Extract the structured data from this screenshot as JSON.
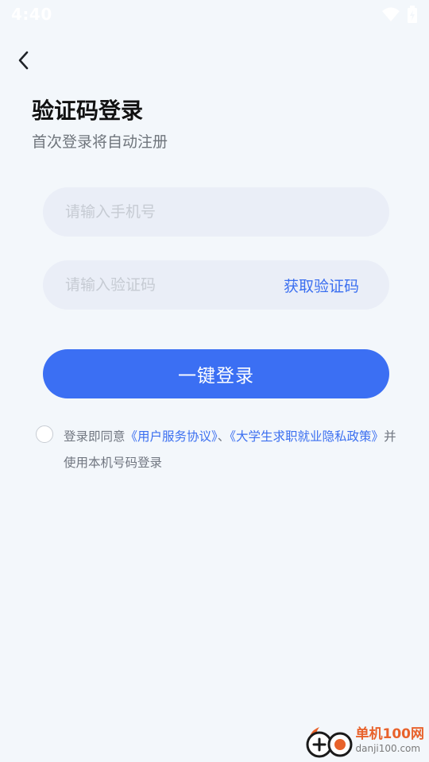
{
  "status_bar": {
    "time": "4:40"
  },
  "header": {
    "back_icon": "chevron-left-icon",
    "title": "验证码登录",
    "subtitle": "首次登录将自动注册"
  },
  "form": {
    "phone_placeholder": "请输入手机号",
    "code_placeholder": "请输入验证码",
    "get_code_label": "获取验证码",
    "login_label": "一键登录"
  },
  "agreement": {
    "prefix": "登录即同意",
    "user_agreement": "《用户服务协议》",
    "separator": "、",
    "privacy_policy": "《大学生求职就业隐私政策》",
    "suffix": "并使用本机号码登录"
  },
  "watermark": {
    "name": "单机100网",
    "url": "danji100.com"
  },
  "colors": {
    "background": "#f3f7fb",
    "accent": "#3b6ff3",
    "input_bg": "#eaeef7",
    "watermark_orange": "#e8622b"
  }
}
